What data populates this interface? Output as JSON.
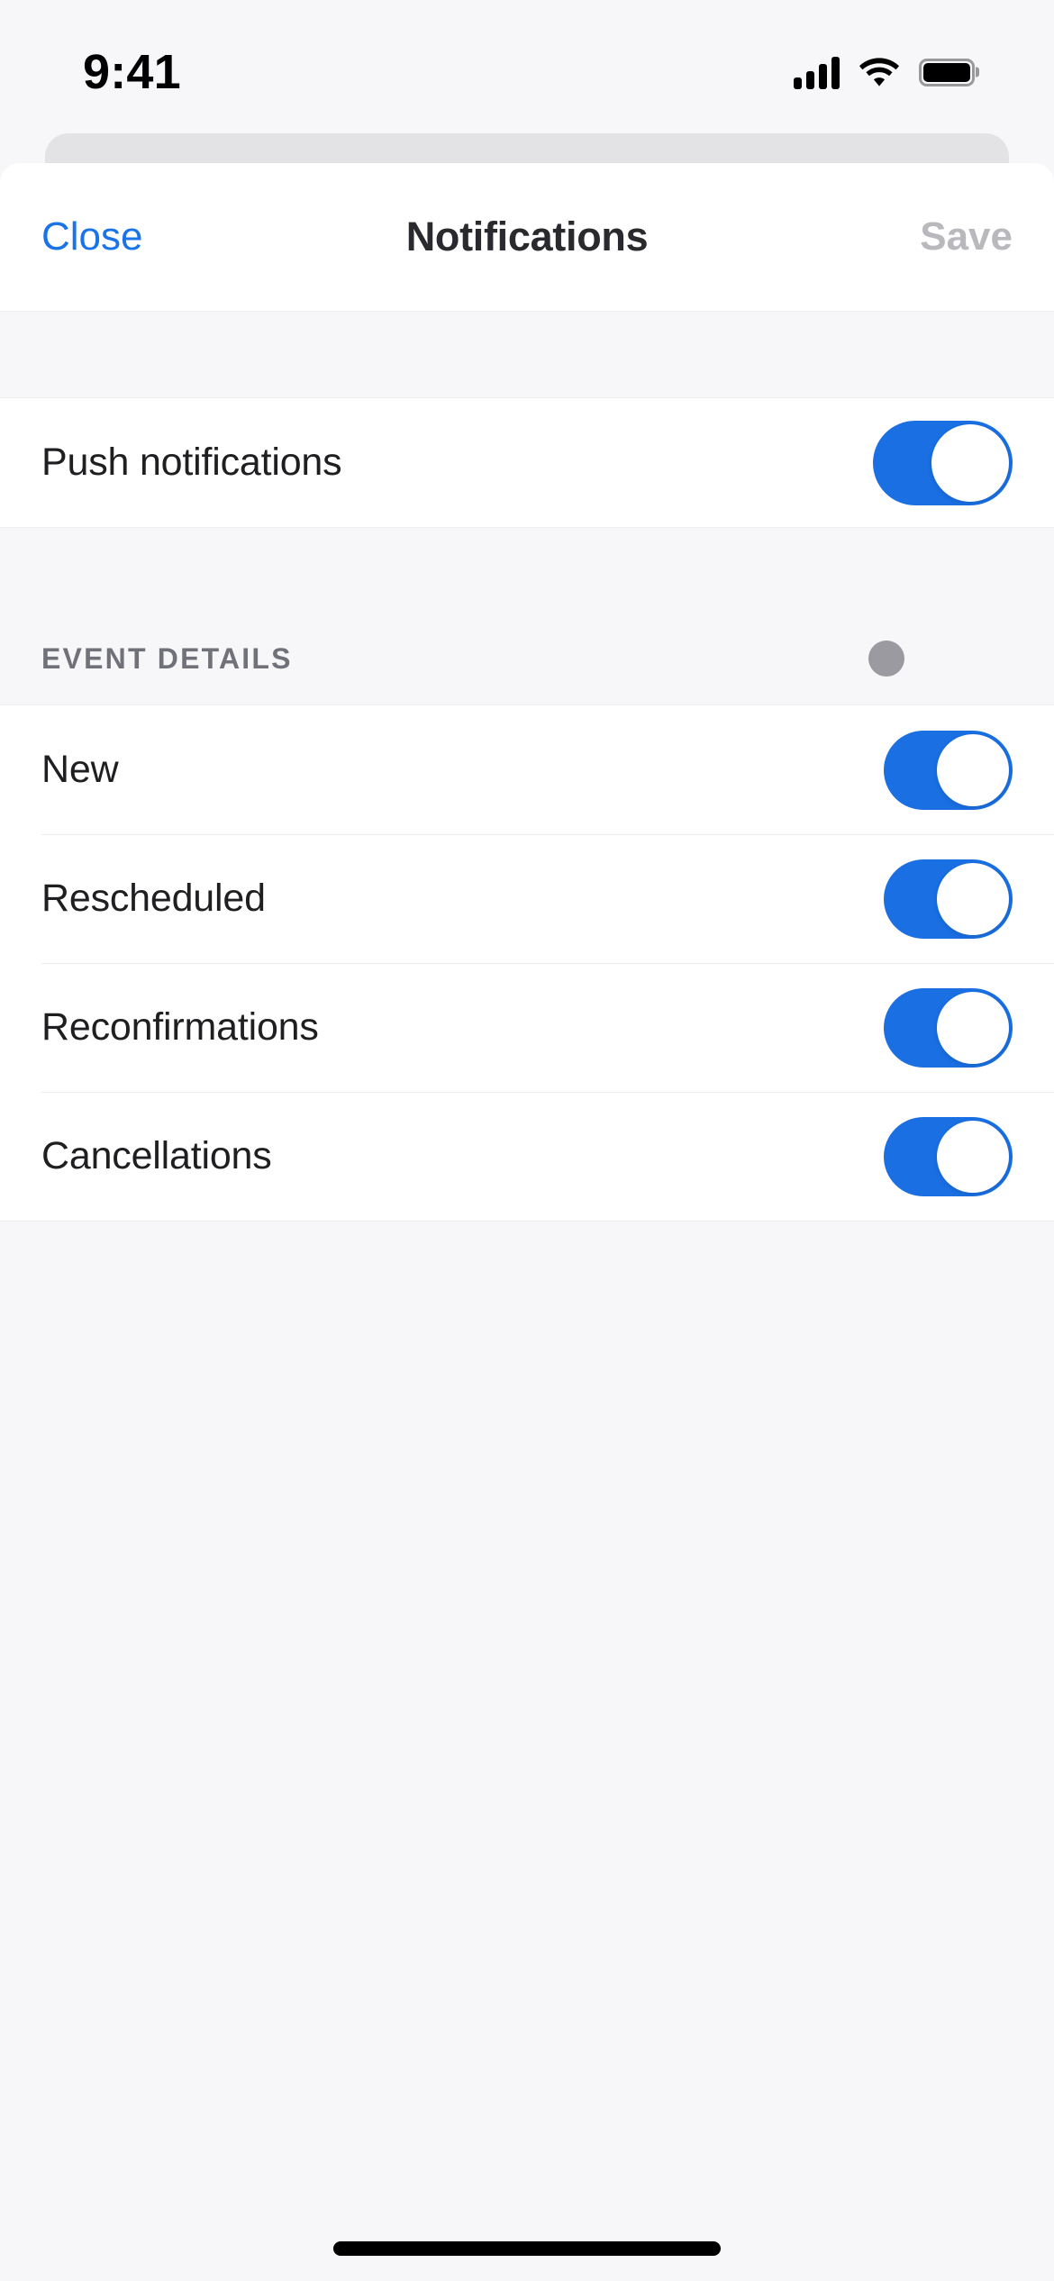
{
  "status_bar": {
    "time": "9:41",
    "cellular_icon": "cellular-signal-icon",
    "wifi_icon": "wifi-icon",
    "battery_icon": "battery-full-icon"
  },
  "navbar": {
    "close_label": "Close",
    "title": "Notifications",
    "save_label": "Save",
    "close_color": "#1a74e8",
    "save_color": "#b8b8bd",
    "title_color": "#2a2a2e"
  },
  "sections": [
    {
      "header": null,
      "rows": [
        {
          "label": "Push notifications",
          "toggle": "on",
          "size": "large"
        }
      ]
    },
    {
      "header": {
        "title": "EVENT DETAILS",
        "dot": true
      },
      "rows": [
        {
          "label": "New",
          "toggle": "on",
          "size": "small"
        },
        {
          "label": "Rescheduled",
          "toggle": "on",
          "size": "small"
        },
        {
          "label": "Reconfirmations",
          "toggle": "on",
          "size": "small"
        },
        {
          "label": "Cancellations",
          "toggle": "on",
          "size": "small"
        }
      ]
    }
  ],
  "colors": {
    "accent_blue": "#1a6fe3",
    "link_blue": "#1a74e8",
    "background": "#f7f7fa",
    "card": "#ffffff",
    "separator": "#ececf0",
    "section_text": "#71717a",
    "dot_gray": "#9a9aa0"
  },
  "home_indicator": "home-indicator"
}
